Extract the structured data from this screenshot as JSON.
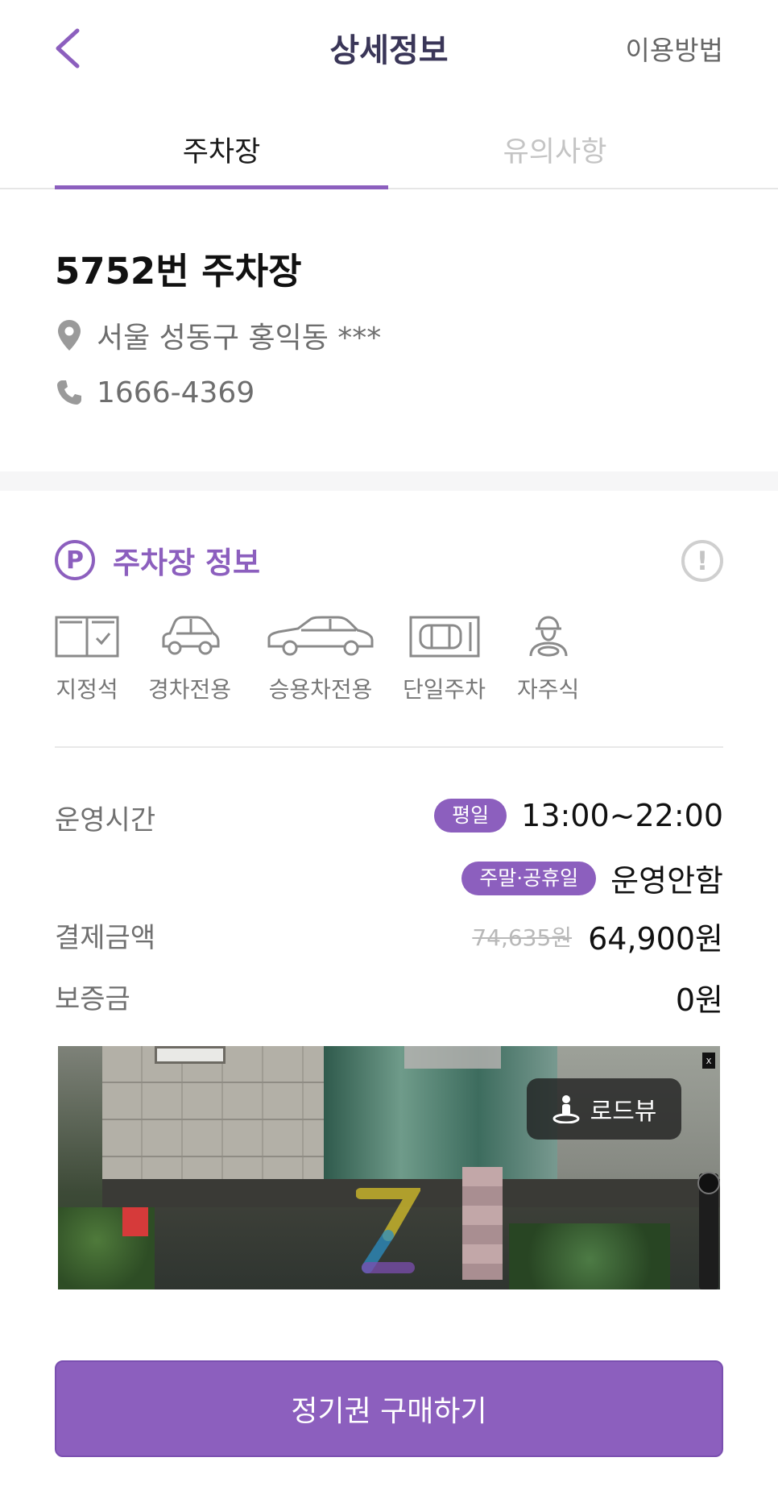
{
  "header": {
    "back_icon": "chevron-left-icon",
    "title": "상세정보",
    "guide_link": "이용방법"
  },
  "tabs": [
    {
      "label": "주차장",
      "active": true
    },
    {
      "label": "유의사항",
      "active": false
    }
  ],
  "lot": {
    "name": "5752번 주차장",
    "address": "서울 성동구 홍익동 ***",
    "phone": "1666-4369"
  },
  "info_section": {
    "title": "주차장 정보",
    "p_icon_letter": "P",
    "alert_symbol": "!",
    "features": [
      {
        "icon": "reserved-seat-icon",
        "label": "지정석"
      },
      {
        "icon": "compact-car-icon",
        "label": "경차전용"
      },
      {
        "icon": "sedan-icon",
        "label": "승용차전용"
      },
      {
        "icon": "single-parking-icon",
        "label": "단일주차"
      },
      {
        "icon": "self-driver-icon",
        "label": "자주식"
      }
    ]
  },
  "hours": {
    "label": "운영시간",
    "weekday_badge": "평일",
    "weekday_value": "13:00~22:00",
    "weekend_badge": "주말·공휴일",
    "weekend_value": "운영안함"
  },
  "payment": {
    "label": "결제금액",
    "original": "74,635원",
    "price": "64,900원"
  },
  "deposit": {
    "label": "보증금",
    "value": "0원"
  },
  "roadview": {
    "button_label": "로드뷰",
    "close_label": "x"
  },
  "cta": {
    "label": "정기권 구매하기"
  },
  "colors": {
    "accent": "#8c5fbe",
    "title_text": "#3a3658"
  }
}
